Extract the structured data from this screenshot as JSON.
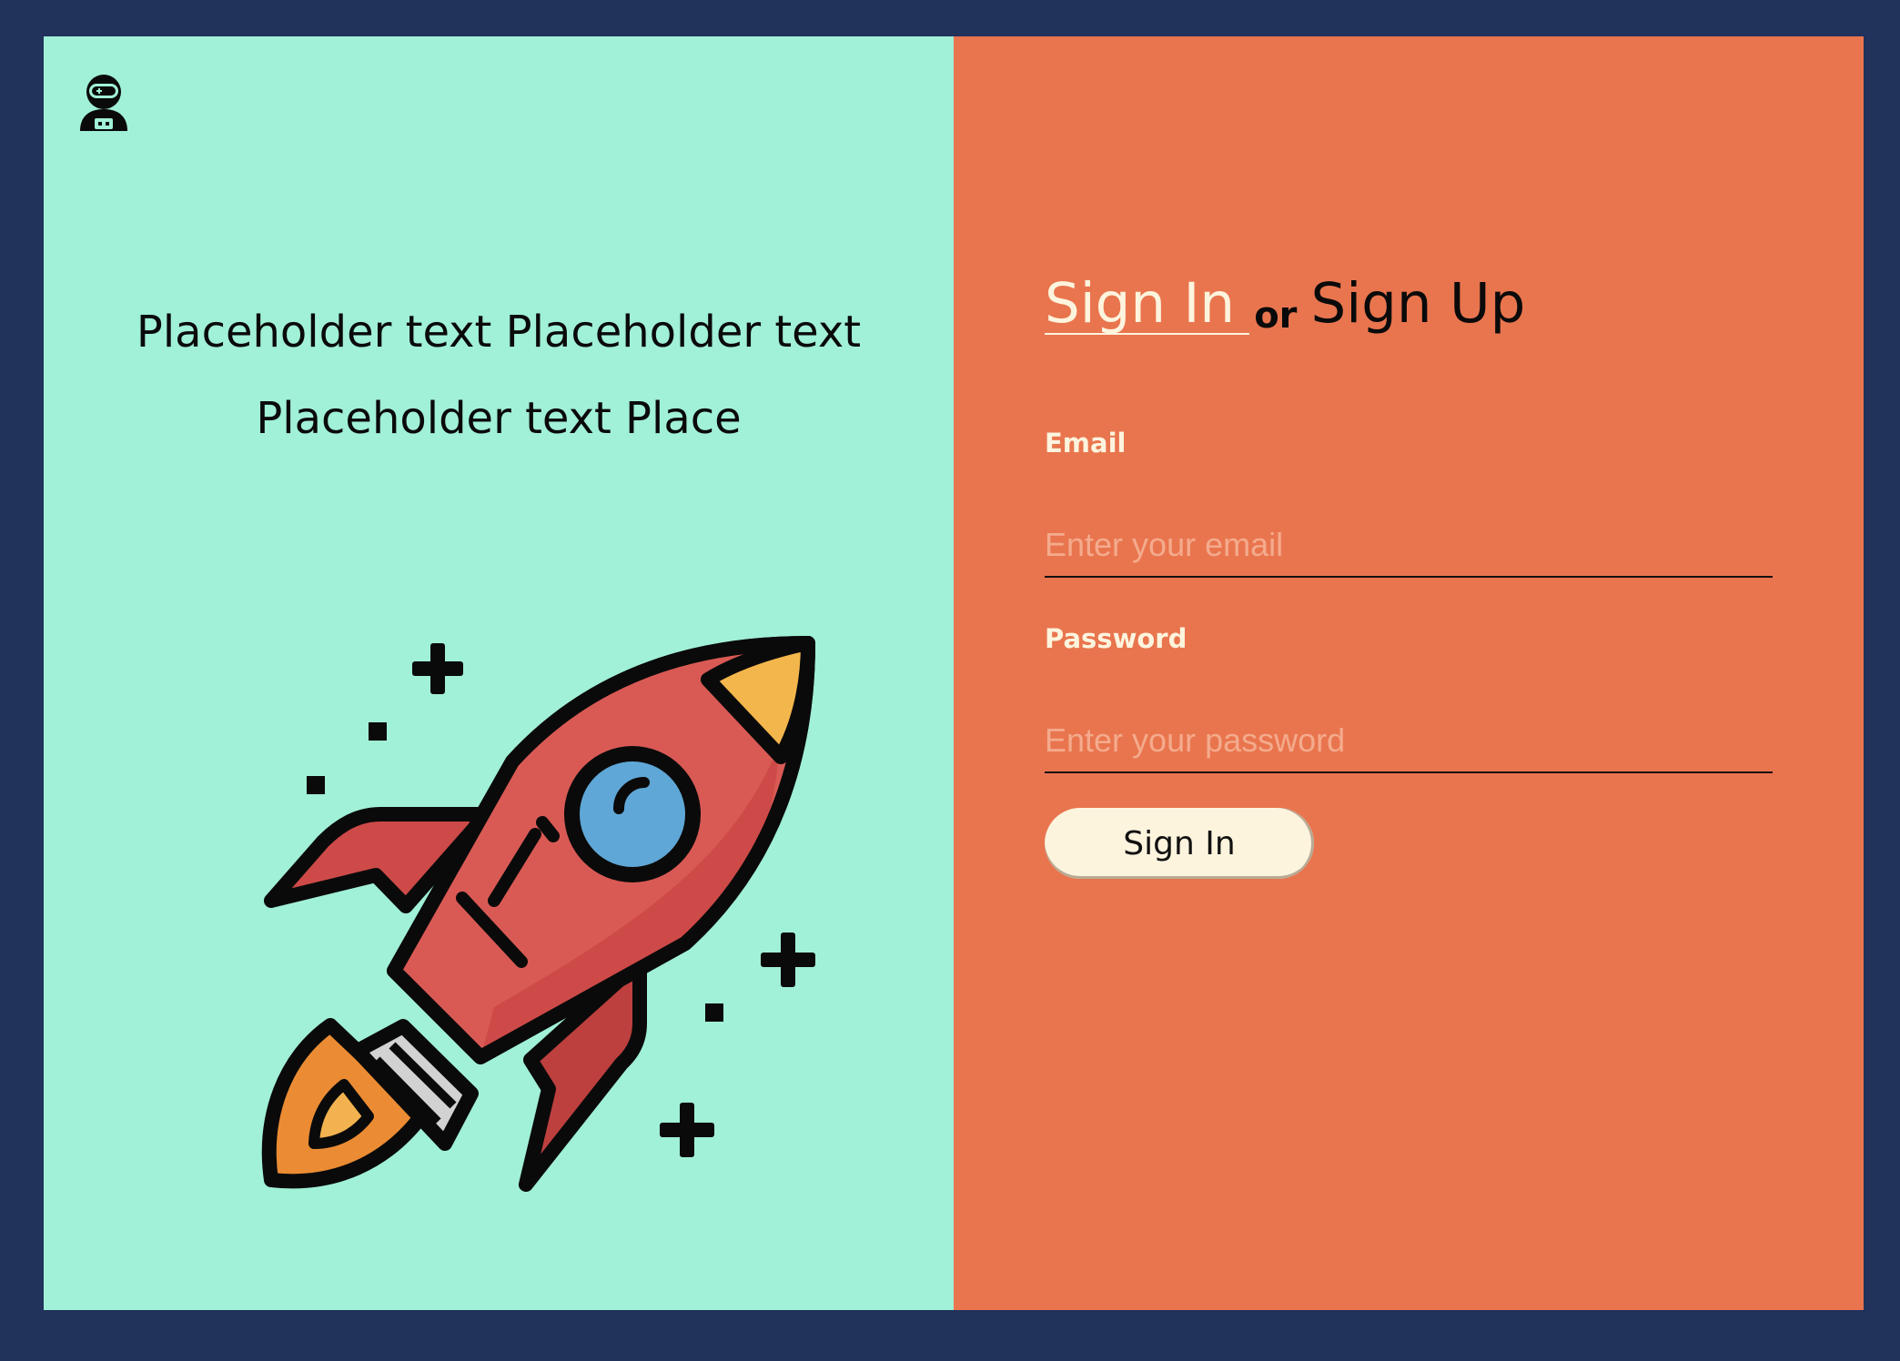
{
  "colors": {
    "page_background": "#21325b",
    "left_panel": "#a1f0d8",
    "right_panel": "#e9754e",
    "accent_cream": "#fdf4de",
    "placeholder": "#f4ab8d"
  },
  "brand": {
    "logo_icon": "astronaut-icon"
  },
  "left": {
    "tagline": "Placeholder text Placeholder text Placeholder text Place",
    "illustration_icon": "rocket-icon"
  },
  "form": {
    "signin_tab": "Sign In",
    "or_text": "or",
    "signup_tab": "Sign Up",
    "email": {
      "label": "Email",
      "placeholder": "Enter your email",
      "value": ""
    },
    "password": {
      "label": "Password",
      "placeholder": "Enter your password",
      "value": ""
    },
    "submit_label": "Sign In"
  }
}
